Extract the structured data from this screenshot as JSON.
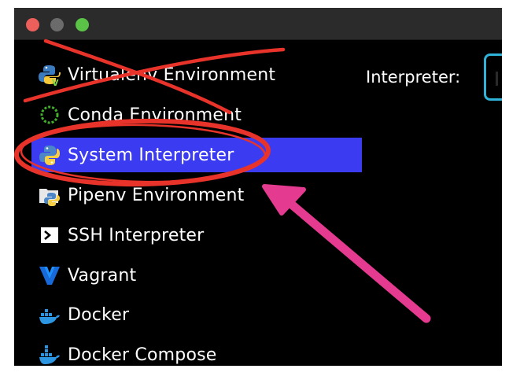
{
  "window": {
    "traffic_lights": [
      "close",
      "minimize",
      "zoom"
    ]
  },
  "sidebar": {
    "items": [
      {
        "label": "Virtualenv Environment",
        "icon": "virtualenv-icon",
        "struck_out": true
      },
      {
        "label": "Conda Environment",
        "icon": "conda-icon",
        "struck_out": true
      },
      {
        "label": "System Interpreter",
        "icon": "python-icon",
        "selected": true,
        "circled": true
      },
      {
        "label": "Pipenv Environment",
        "icon": "pipenv-icon"
      },
      {
        "label": "SSH Interpreter",
        "icon": "ssh-terminal-icon"
      },
      {
        "label": "Vagrant",
        "icon": "vagrant-icon"
      },
      {
        "label": "Docker",
        "icon": "docker-icon"
      },
      {
        "label": "Docker Compose",
        "icon": "docker-compose-icon"
      }
    ]
  },
  "main": {
    "interpreter_label": "Interpreter:",
    "interpreter_value": ""
  },
  "colors": {
    "selected_background": "#3b3bf2",
    "field_border": "#30b3d9",
    "annotation_red": "#e8332a",
    "annotation_pink": "#e43a8f"
  }
}
